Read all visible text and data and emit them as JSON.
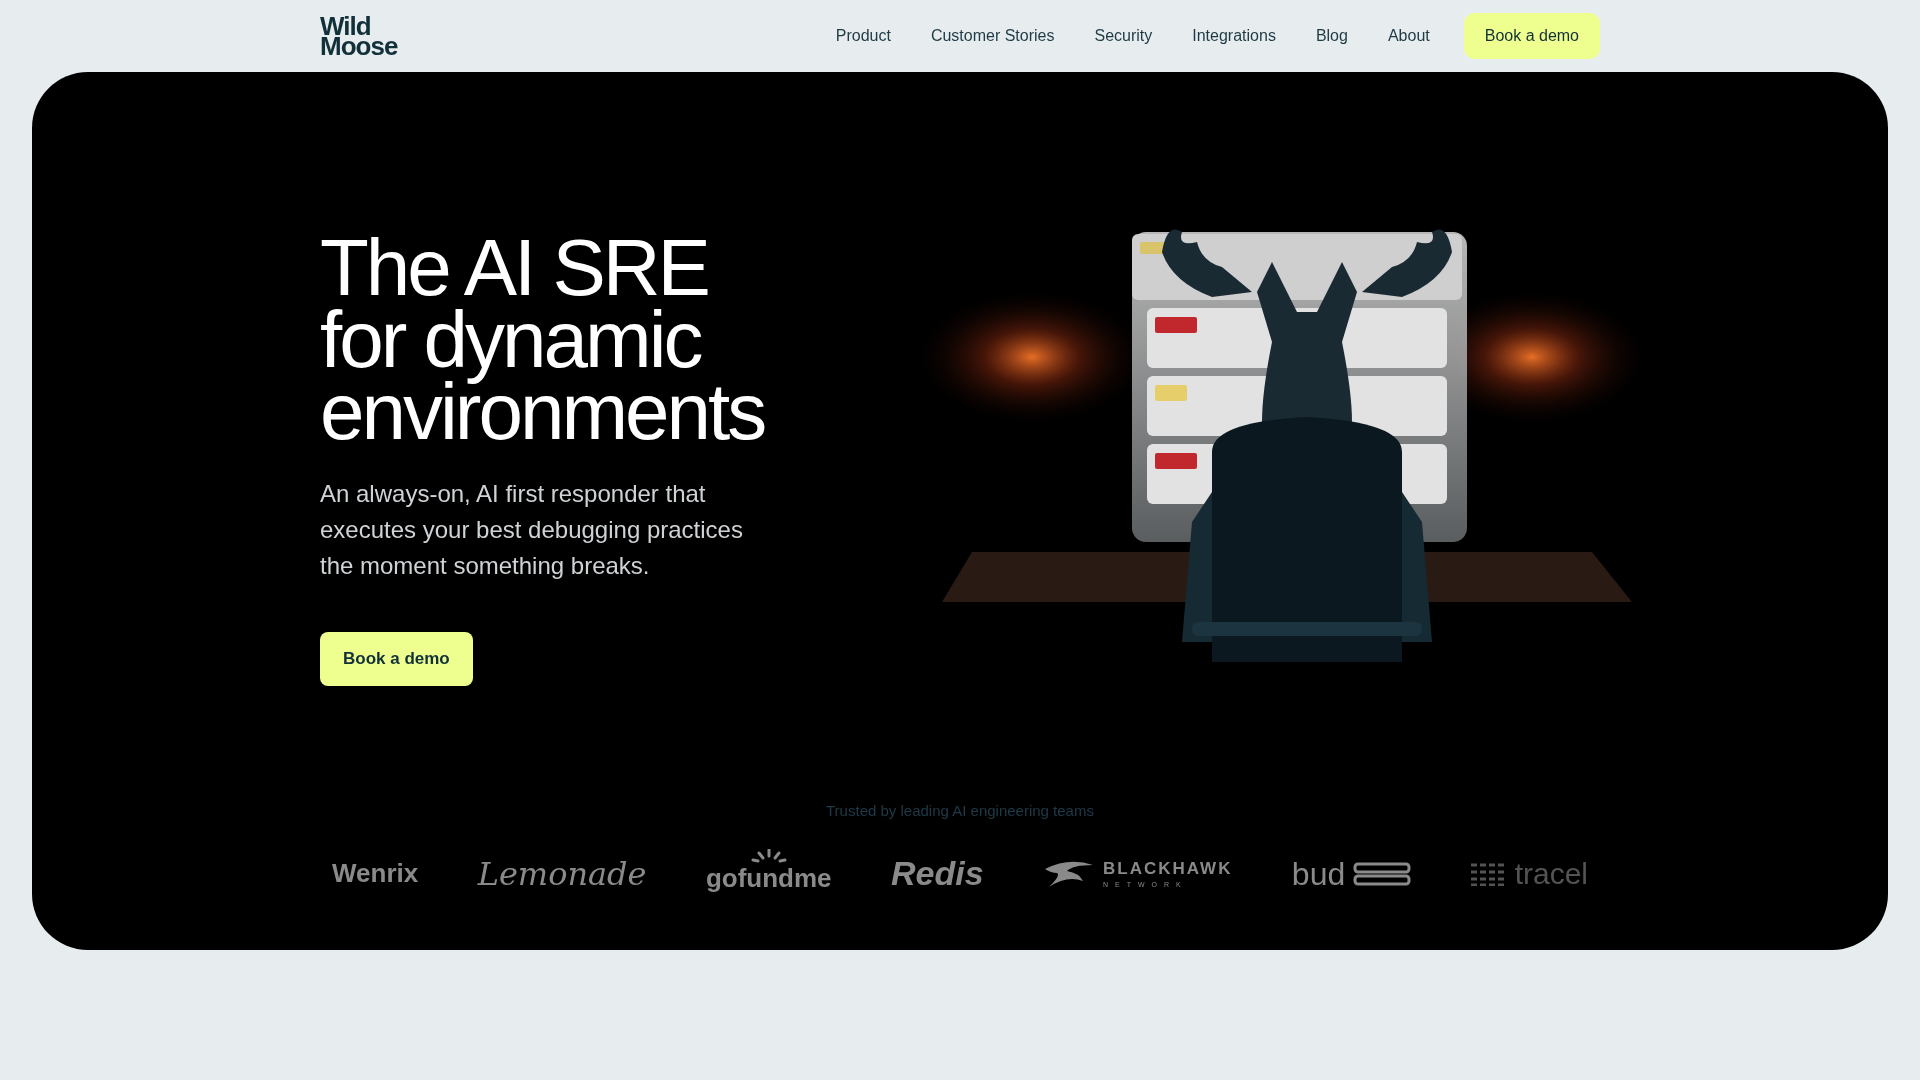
{
  "header": {
    "logo": [
      "Wild",
      "Moose"
    ],
    "nav": [
      "Product",
      "Customer Stories",
      "Security",
      "Integrations",
      "Blog",
      "About"
    ],
    "cta": "Book a demo"
  },
  "hero": {
    "title": [
      "The AI SRE",
      "for dynamic",
      "environments"
    ],
    "subtitle": "An always-on, AI first responder that executes your best debugging practices the moment something breaks.",
    "cta": "Book a demo"
  },
  "trusted": {
    "caption": "Trusted by leading AI engineering teams",
    "logos": [
      {
        "name": "Wenrix",
        "kind": "plain"
      },
      {
        "name": "Lemonade",
        "kind": "script"
      },
      {
        "name": "gofundme",
        "kind": "sun"
      },
      {
        "name": "Redis",
        "kind": "bold"
      },
      {
        "name": "BLACKHAWK",
        "sub": "NETWORK",
        "kind": "hawk"
      },
      {
        "name": "bud",
        "kind": "bars"
      },
      {
        "name": "tracel",
        "kind": "grid"
      }
    ]
  }
}
